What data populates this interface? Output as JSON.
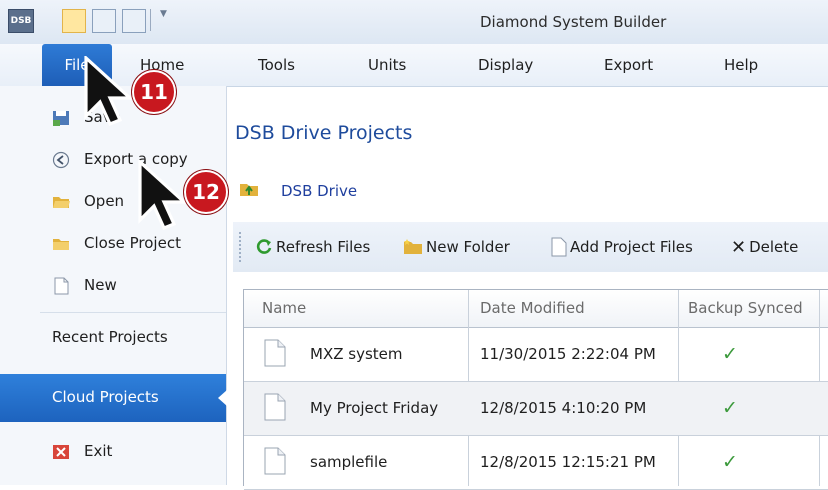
{
  "window": {
    "title": "Diamond System Builder",
    "logo_text": "DSB"
  },
  "ribbon_tabs": [
    "File",
    "Home",
    "Tools",
    "Units",
    "Display",
    "Export",
    "Help"
  ],
  "file_menu": {
    "items": [
      {
        "label": "Save",
        "icon": "save-icon"
      },
      {
        "label": "Export a copy",
        "icon": "export-icon"
      },
      {
        "label": "Open",
        "icon": "folder-open-icon"
      },
      {
        "label": "Close Project",
        "icon": "close-project-icon"
      },
      {
        "label": "New",
        "icon": "new-document-icon"
      }
    ],
    "recent_projects": "Recent Projects",
    "cloud_projects": "Cloud Projects",
    "exit": "Exit"
  },
  "content": {
    "title": "DSB Drive Projects",
    "breadcrumb": "DSB Drive",
    "toolbar": {
      "refresh": "Refresh Files",
      "new_folder": "New Folder",
      "add_files": "Add Project Files",
      "delete": "Delete"
    },
    "table": {
      "columns": [
        "Name",
        "Date Modified",
        "Backup Synced"
      ],
      "rows": [
        {
          "name": "MXZ system",
          "date": "11/30/2015 2:22:04 PM",
          "synced": "✓"
        },
        {
          "name": "My Project Friday",
          "date": "12/8/2015 4:10:20 PM",
          "synced": "✓"
        },
        {
          "name": "samplefile",
          "date": "12/8/2015 12:15:21 PM",
          "synced": "✓"
        }
      ]
    }
  },
  "annotations": {
    "step1": "11",
    "step2": "12"
  },
  "colors": {
    "file_tab": "#1e5eb7",
    "selected": "#2f80db",
    "marker": "#c8181f",
    "check": "#3c9a3c",
    "link": "#1e4b9c"
  }
}
